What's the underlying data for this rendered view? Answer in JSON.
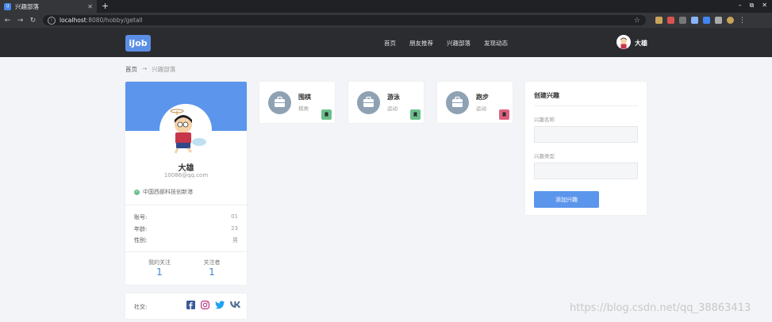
{
  "browser": {
    "tab_title": "兴趣部落",
    "tab_favicon_text": "iJ",
    "new_tab_label": "+",
    "url_host": "localhost",
    "url_rest": ":8080/hobby/getall",
    "window_controls": [
      "–",
      "⧉",
      "✕"
    ]
  },
  "app": {
    "logo": "iJob",
    "nav": [
      "首页",
      "朋友推荐",
      "兴趣部落",
      "发现动态"
    ],
    "user_name": "大雄"
  },
  "breadcrumb": {
    "home": "首页",
    "arrow": "→",
    "current": "兴趣部落"
  },
  "profile": {
    "name": "大雄",
    "email": "10086@qq.com",
    "location": "中国西部科技创新港",
    "fields": [
      {
        "label": "账号:",
        "value": "01"
      },
      {
        "label": "年龄:",
        "value": "23"
      },
      {
        "label": "性别:",
        "value": "男"
      }
    ],
    "following_label": "我的关注",
    "following_count": "1",
    "followers_label": "关注者",
    "followers_count": "1"
  },
  "social": {
    "label": "社交:",
    "icons": [
      "facebook-icon",
      "instagram-icon",
      "twitter-icon",
      "vk-icon"
    ]
  },
  "hobbies": [
    {
      "name": "围棋",
      "type": "棋类",
      "badge_color": "#6cc08b"
    },
    {
      "name": "游泳",
      "type": "运动",
      "badge_color": "#6cc08b"
    },
    {
      "name": "跑步",
      "type": "运动",
      "badge_color": "#e0607e"
    }
  ],
  "create_form": {
    "title": "创建兴趣",
    "name_label": "兴趣名称",
    "type_label": "兴趣类型",
    "name_value": "",
    "type_value": "",
    "submit_label": "添加兴趣"
  },
  "watermark": "https://blog.csdn.net/qq_38863413",
  "colors": {
    "accent": "#5b95ec",
    "header_bg": "#2a2c30",
    "page_bg": "#f3f4f7"
  }
}
